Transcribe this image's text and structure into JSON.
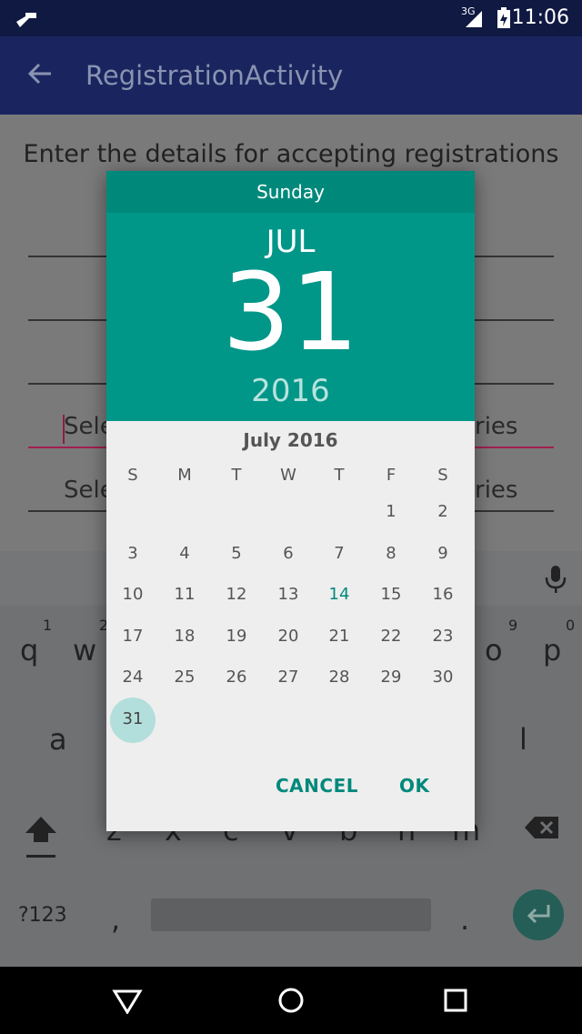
{
  "status_bar": {
    "network": "3G",
    "time": "11:06"
  },
  "app_bar": {
    "title": "RegistrationActivity"
  },
  "content": {
    "heading": "Enter the details for accepting registrations",
    "field1_left": "Sele",
    "field1_right": "ries",
    "field2_left": "Sele",
    "field2_right": "ries"
  },
  "keyboard": {
    "row1": [
      "q",
      "w",
      "o",
      "p"
    ],
    "row1_hints": [
      "1",
      "2",
      "9",
      "0"
    ],
    "row2": [
      "a",
      "l"
    ],
    "row3": [
      "z",
      "x",
      "c",
      "v",
      "b",
      "n",
      "m"
    ],
    "symbols": "?123",
    "comma": ",",
    "period": "."
  },
  "dialog": {
    "day_name": "Sunday",
    "month": "JUL",
    "day": "31",
    "year": "2016",
    "calendar_title": "July 2016",
    "weekdays": [
      "S",
      "M",
      "T",
      "W",
      "T",
      "F",
      "S"
    ],
    "weeks": [
      [
        "",
        "",
        "",
        "",
        "",
        "1",
        "2"
      ],
      [
        "3",
        "4",
        "5",
        "6",
        "7",
        "8",
        "9"
      ],
      [
        "10",
        "11",
        "12",
        "13",
        "14",
        "15",
        "16"
      ],
      [
        "17",
        "18",
        "19",
        "20",
        "21",
        "22",
        "23"
      ],
      [
        "24",
        "25",
        "26",
        "27",
        "28",
        "29",
        "30"
      ],
      [
        "31",
        "",
        "",
        "",
        "",
        "",
        ""
      ]
    ],
    "today": "14",
    "selected": "31",
    "cancel_label": "CANCEL",
    "ok_label": "OK"
  },
  "colors": {
    "accent": "#009688",
    "accent_dark": "#00897b",
    "selected_circle": "#b2dfdb"
  }
}
